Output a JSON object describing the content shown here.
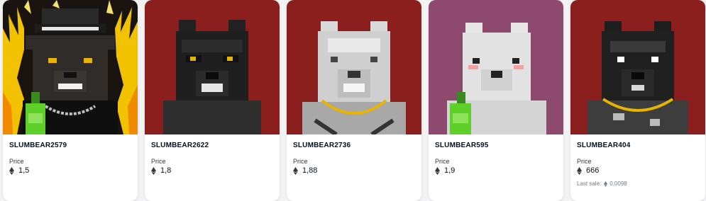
{
  "colors": {
    "card_bg": "#ffffff",
    "bg_red": "#8b1f1e",
    "bg_purple": "#8e4a6e",
    "text_main": "#04111d",
    "text_muted": "#707a83"
  },
  "price_label": "Price",
  "last_sale_label": "Last sale:",
  "cards": [
    {
      "name": "SLUMBEAR2579",
      "price": "1,5",
      "icon": "ethereum-icon",
      "background": "dark-yellow-fire"
    },
    {
      "name": "SLUMBEAR2622",
      "price": "1,8",
      "icon": "ethereum-icon",
      "background": "red"
    },
    {
      "name": "SLUMBEAR2736",
      "price": "1,88",
      "icon": "ethereum-icon",
      "background": "red"
    },
    {
      "name": "SLUMBEAR595",
      "price": "1,9",
      "icon": "ethereum-icon",
      "background": "purple"
    },
    {
      "name": "SLUMBEAR404",
      "price": "666",
      "icon": "ethereum-icon",
      "background": "red",
      "last_sale": "0,0098"
    }
  ]
}
